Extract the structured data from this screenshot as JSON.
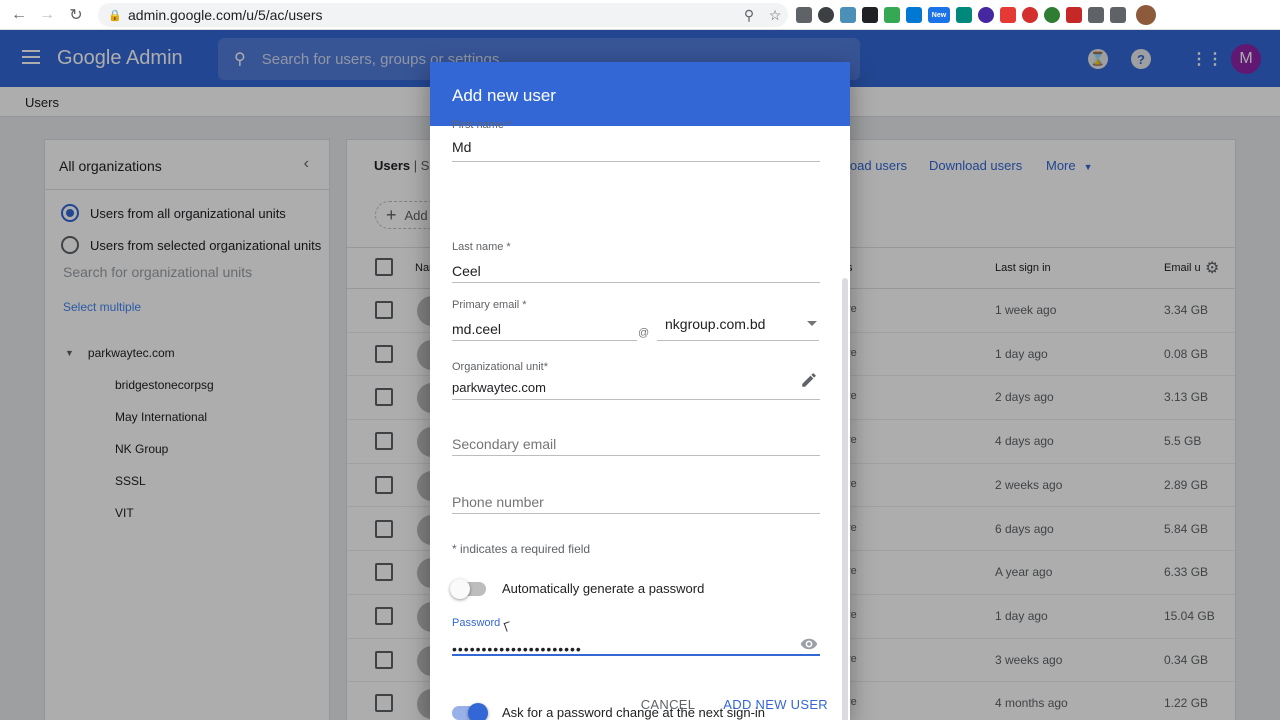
{
  "browser": {
    "url": "admin.google.com/u/5/ac/users",
    "extensions_new_badge": "New"
  },
  "header": {
    "brand": "Google Admin",
    "search_placeholder": "Search for users, groups or settings",
    "avatar_initial": "M",
    "help_label": "?"
  },
  "breadcrumb": "Users",
  "org_panel": {
    "title": "All organizations",
    "radio_all": "Users from all organizational units",
    "radio_selected": "Users from selected organizational units",
    "search_placeholder": "Search for organizational units",
    "select_multiple": "Select multiple",
    "root": "parkwaytec.com",
    "children": [
      "bridgestonecorpsg",
      "May International",
      "NK Group",
      "SSSL",
      "VIT"
    ]
  },
  "users_panel": {
    "title_prefix": "Users",
    "title_frag": "| Sh",
    "upload_frag": "load users",
    "download": "Download users",
    "more": "More",
    "add_frag": "Add",
    "col_name": "Nam",
    "col_status_frag": "s",
    "col_last_sign_in": "Last sign in",
    "col_email_frag": "Email u",
    "rows": [
      {
        "frag": "re",
        "last": "1 week ago",
        "storage": "3.34 GB"
      },
      {
        "frag": "re",
        "last": "1 day ago",
        "storage": "0.08 GB"
      },
      {
        "frag": "re",
        "last": "2 days ago",
        "storage": "3.13 GB"
      },
      {
        "frag": "re",
        "last": "4 days ago",
        "storage": "5.5 GB"
      },
      {
        "frag": "re",
        "last": "2 weeks ago",
        "storage": "2.89 GB"
      },
      {
        "frag": "re",
        "last": "6 days ago",
        "storage": "5.84 GB"
      },
      {
        "frag": "re",
        "last": "A year ago",
        "storage": "6.33 GB"
      },
      {
        "frag": "re",
        "last": "1 day ago",
        "storage": "15.04 GB"
      },
      {
        "frag": "re",
        "last": "3 weeks ago",
        "storage": "0.34 GB"
      },
      {
        "frag": "re",
        "last": "4 months ago",
        "storage": "1.22 GB"
      }
    ]
  },
  "dialog": {
    "title": "Add new user",
    "first_name_label": "First name *",
    "first_name_value": "Md",
    "last_name_label": "Last name *",
    "last_name_value": "Ceel",
    "primary_email_label": "Primary email *",
    "primary_email_value": "md.ceel",
    "at_sign": "@",
    "domain_value": "nkgroup.com.bd",
    "org_unit_label": "Organizational unit*",
    "org_unit_value": "parkwaytec.com",
    "secondary_email_placeholder": "Secondary email",
    "phone_placeholder": "Phone number",
    "required_note": "* indicates a required field",
    "auto_password_label": "Automatically generate a password",
    "auto_password_on": false,
    "password_label": "Password",
    "password_value": "••••••••••••••••••••••",
    "ask_change_label": "Ask for a password change at the next sign-in",
    "ask_change_on": true,
    "cancel_label": "CANCEL",
    "submit_label": "ADD NEW USER"
  },
  "colors": {
    "brand_blue": "#3367d6",
    "avatar_purple": "#8e24aa"
  }
}
